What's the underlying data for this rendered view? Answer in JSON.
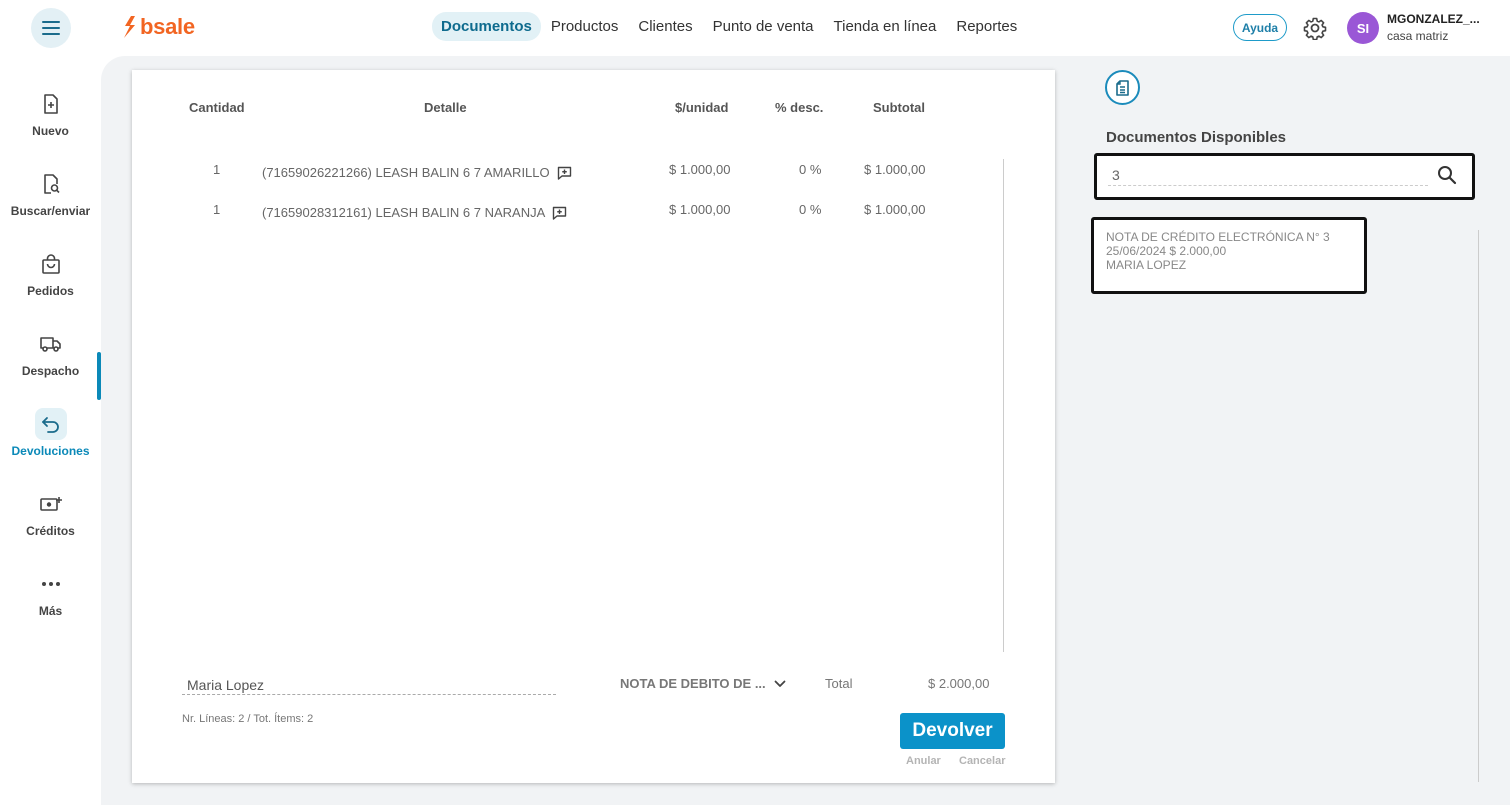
{
  "brand": {
    "name": "bsale",
    "color": "#f26522"
  },
  "nav": {
    "items": [
      {
        "label": "Documentos",
        "active": true
      },
      {
        "label": "Productos",
        "active": false
      },
      {
        "label": "Clientes",
        "active": false
      },
      {
        "label": "Punto de venta",
        "active": false
      },
      {
        "label": "Tienda en línea",
        "active": false
      },
      {
        "label": "Reportes",
        "active": false
      }
    ]
  },
  "header": {
    "help_label": "Ayuda",
    "avatar_initials": "SI",
    "user_name": "MGONZALEZ_...",
    "branch": "casa matriz"
  },
  "sidebar": {
    "items": [
      {
        "label": "Nuevo",
        "icon": "new-document-icon"
      },
      {
        "label": "Buscar/enviar",
        "icon": "search-document-icon"
      },
      {
        "label": "Pedidos",
        "icon": "shopping-bag-icon"
      },
      {
        "label": "Despacho",
        "icon": "truck-icon"
      },
      {
        "label": "Devoluciones",
        "icon": "return-arrow-icon",
        "active": true
      },
      {
        "label": "Créditos",
        "icon": "money-plus-icon"
      },
      {
        "label": "Más",
        "icon": "more-dots-icon"
      }
    ]
  },
  "table": {
    "headers": {
      "quantity": "Cantidad",
      "detail": "Detalle",
      "unit_price": "$/unidad",
      "discount": "% desc.",
      "subtotal": "Subtotal"
    },
    "rows": [
      {
        "quantity": "1",
        "detail": "(71659026221266) LEASH BALIN 6 7 AMARILLO",
        "unit_price": "$ 1.000,00",
        "discount": "0 %",
        "subtotal": "$ 1.000,00"
      },
      {
        "quantity": "1",
        "detail": "(71659028312161) LEASH BALIN 6 7 NARANJA",
        "unit_price": "$ 1.000,00",
        "discount": "0 %",
        "subtotal": "$ 1.000,00"
      }
    ]
  },
  "footer": {
    "client_value": "Maria Lopez",
    "document_type": "NOTA DE DEBITO DE ...",
    "total_label": "Total",
    "total_value": "$ 2.000,00",
    "lines_info": "Nr. Líneas: 2 / Tot. Ítems: 2",
    "return_button": "Devolver",
    "void_link": "Anular",
    "cancel_link": "Cancelar"
  },
  "right_panel": {
    "title": "Documentos Disponibles",
    "search_value": "3",
    "results": [
      {
        "line1": "NOTA DE CRÉDITO ELECTRÓNICA N° 3",
        "line2": "25/06/2024 $ 2.000,00",
        "line3": "MARIA LOPEZ"
      }
    ]
  },
  "colors": {
    "accent": "#0b92c9",
    "nav_active_bg": "#e2f1f6",
    "avatar": "#9a57d6"
  }
}
